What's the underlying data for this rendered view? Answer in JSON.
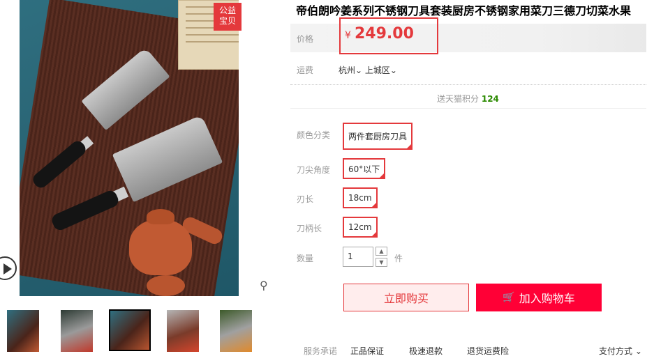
{
  "gallery": {
    "charity_badge": "公益\n宝贝",
    "charity_line1": "公益",
    "charity_line2": "宝贝",
    "play_icon": "play-icon",
    "zoom_icon": "zoom-icon",
    "thumbnails": [
      "thumb-1",
      "thumb-2",
      "thumb-3",
      "thumb-4",
      "thumb-5"
    ],
    "selected_thumb": 3
  },
  "product": {
    "title": "帝伯朗吟姜系列不锈钢刀具套装厨房不锈钢家用菜刀三德刀切菜水果",
    "price_label": "价格",
    "price_symbol": "¥",
    "price": "249.00",
    "shipping_label": "运费",
    "shipping_city": "杭州",
    "shipping_district": "上城区",
    "points_text": "送天猫积分",
    "points_value": "124"
  },
  "options": {
    "color_label": "颜色分类",
    "color_value": "两件套厨房刀具",
    "tip_label": "刀尖角度",
    "tip_value": "60°以下",
    "blade_label": "刃长",
    "blade_value": "18cm",
    "handle_label": "刀柄长",
    "handle_value": "12cm",
    "qty_label": "数量",
    "qty_value": "1",
    "qty_unit": "件"
  },
  "actions": {
    "buy_now": "立即购买",
    "add_cart": "加入购物车"
  },
  "services": {
    "label": "服务承诺",
    "items": [
      "正品保证",
      "极速退款",
      "退货运费险"
    ],
    "pay_label": "支付方式"
  },
  "colors": {
    "accent": "#e4393c",
    "cart_button": "#ff0036",
    "points_green": "#2b8a00"
  }
}
